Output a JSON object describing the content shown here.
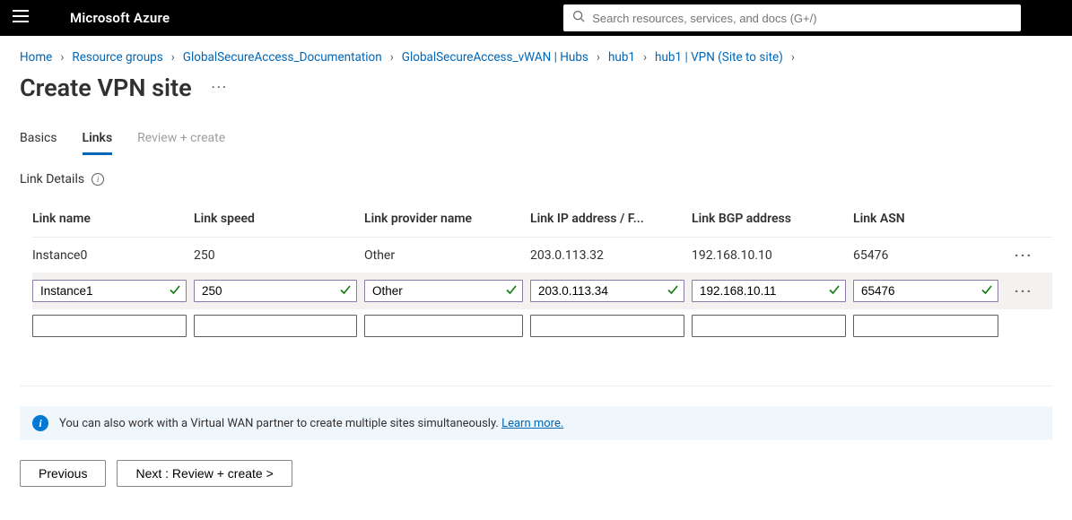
{
  "header": {
    "brand": "Microsoft Azure",
    "search_placeholder": "Search resources, services, and docs (G+/)"
  },
  "breadcrumbs": [
    "Home",
    "Resource groups",
    "GlobalSecureAccess_Documentation",
    "GlobalSecureAccess_vWAN | Hubs",
    "hub1",
    "hub1 | VPN (Site to site)"
  ],
  "page_title": "Create VPN site",
  "tabs": {
    "basics": "Basics",
    "links": "Links",
    "review": "Review + create"
  },
  "section": {
    "label": "Link Details"
  },
  "columns": {
    "name": "Link name",
    "speed": "Link speed",
    "provider": "Link provider name",
    "ip": "Link IP address / F...",
    "bgp": "Link BGP address",
    "asn": "Link ASN"
  },
  "rows": [
    {
      "name": "Instance0",
      "speed": "250",
      "provider": "Other",
      "ip": "203.0.113.32",
      "bgp": "192.168.10.10",
      "asn": "65476"
    },
    {
      "name": "Instance1",
      "speed": "250",
      "provider": "Other",
      "ip": "203.0.113.34",
      "bgp": "192.168.10.11",
      "asn": "65476"
    }
  ],
  "info_banner": {
    "text": "You can also work with a Virtual WAN partner to create multiple sites simultaneously. ",
    "link": "Learn more."
  },
  "buttons": {
    "previous": "Previous",
    "next": "Next : Review + create >"
  }
}
